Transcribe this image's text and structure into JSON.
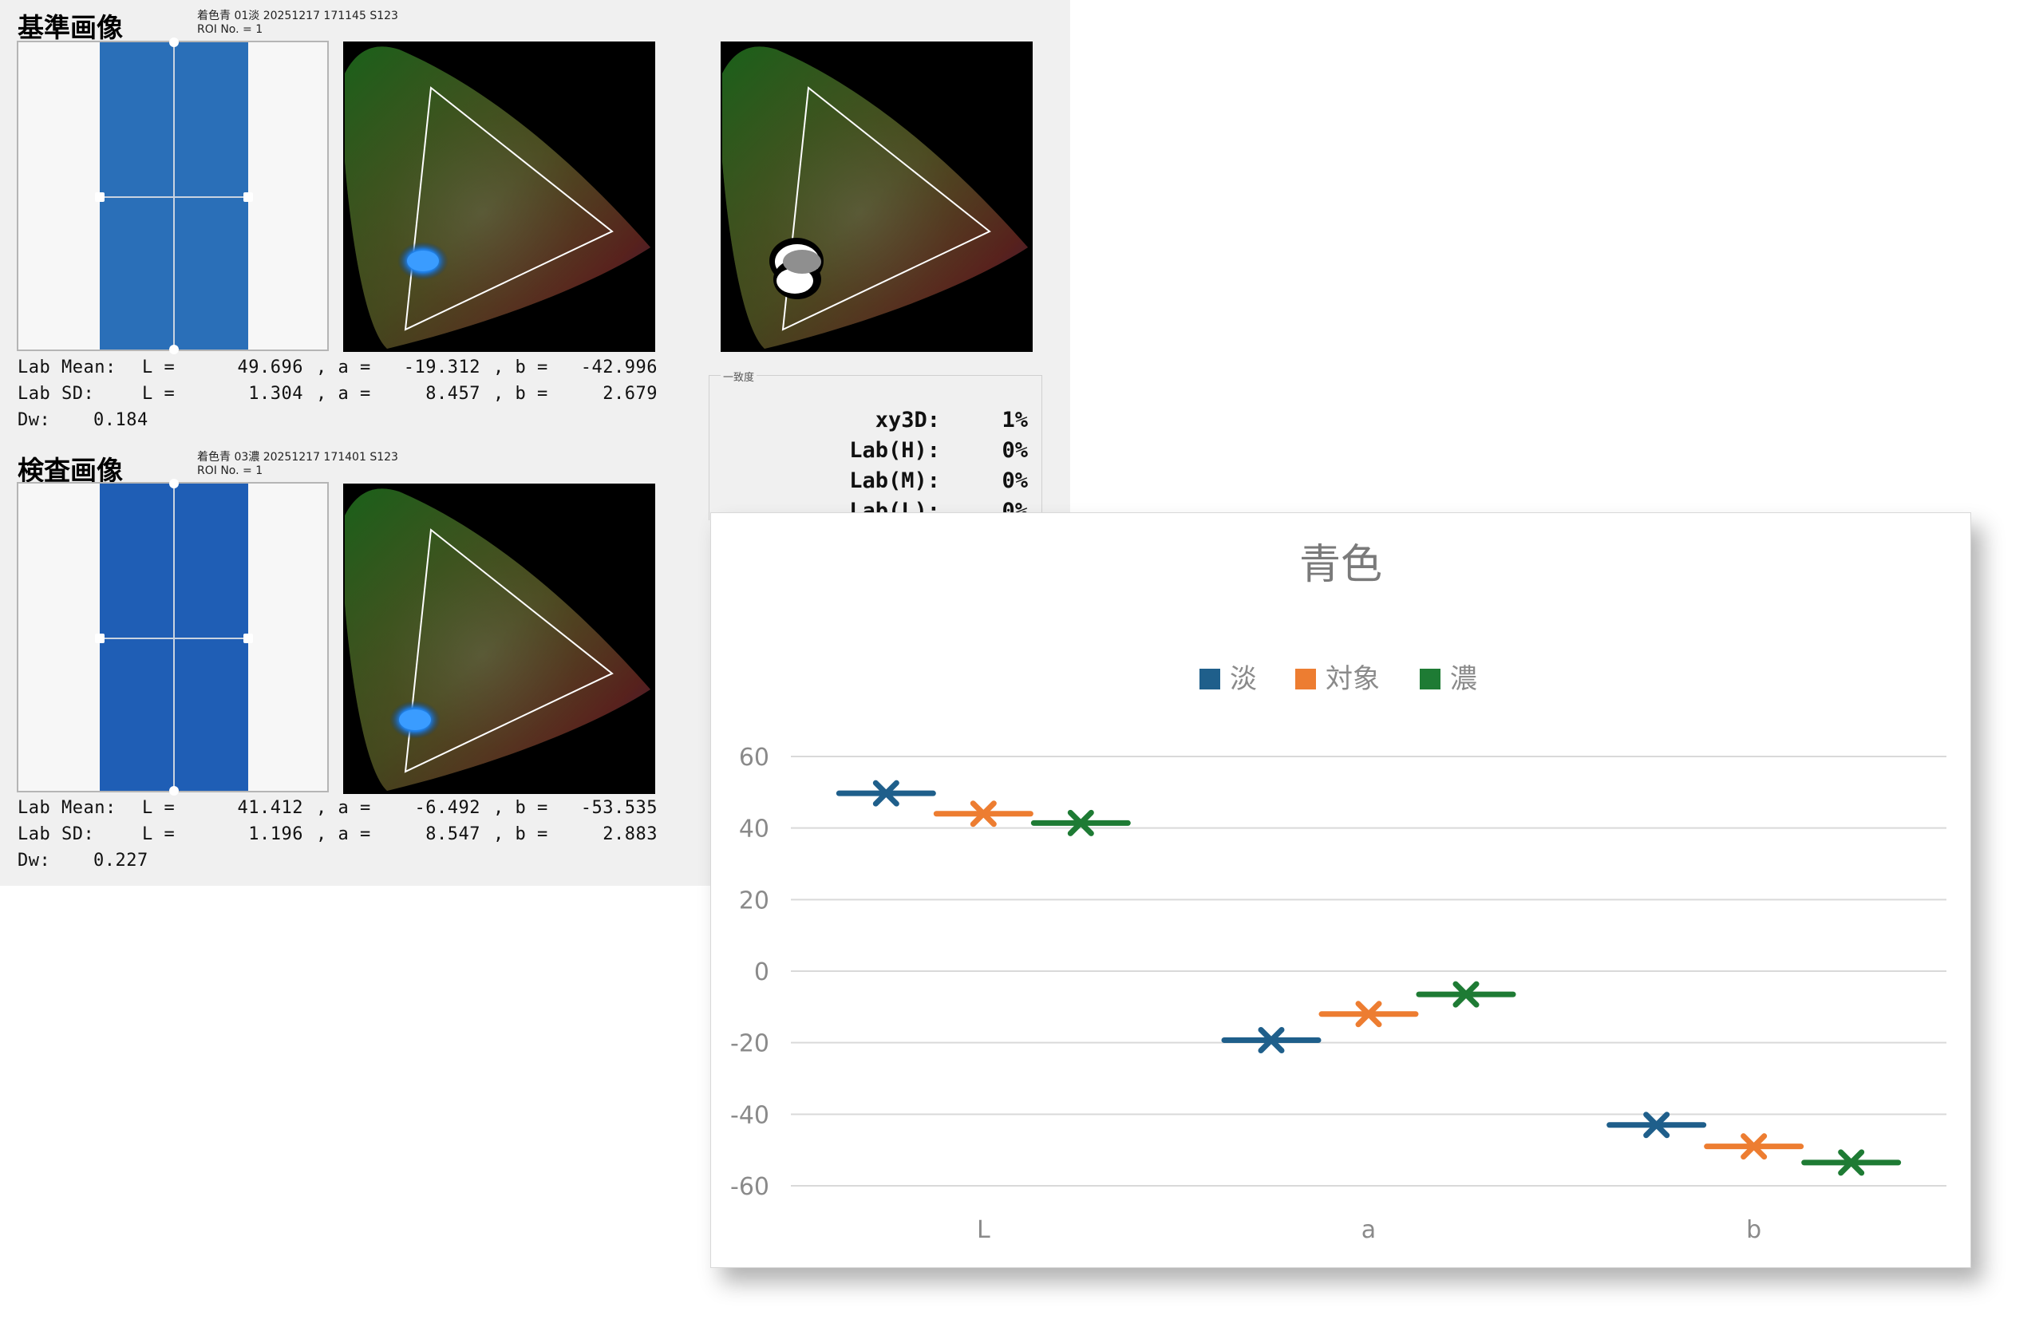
{
  "reference": {
    "title": "基準画像",
    "meta_line1": "着色青 01淡 20251217 171145 S123",
    "meta_line2": "ROI No. = 1",
    "roi_color": "#2a6fb8",
    "lab_mean": {
      "label": "Lab Mean:",
      "L": "49.696",
      "a": "-19.312",
      "b": "-42.996"
    },
    "lab_sd": {
      "label": "Lab SD:",
      "L": "1.304",
      "a": "8.457",
      "b": "2.679"
    },
    "dw": {
      "label": "Dw:",
      "value": "0.184"
    }
  },
  "inspection": {
    "title": "検査画像",
    "meta_line1": "着色青 03濃 20251217 171401 S123",
    "meta_line2": "ROI No. = 1",
    "roi_color": "#1f5eb5",
    "lab_mean": {
      "label": "Lab Mean:",
      "L": "41.412",
      "a": "-6.492",
      "b": "-53.535"
    },
    "lab_sd": {
      "label": "Lab SD:",
      "L": "1.196",
      "a": "8.547",
      "b": "2.883"
    },
    "dw": {
      "label": "Dw:",
      "value": "0.227"
    }
  },
  "consistency": {
    "group_label": "一致度",
    "rows": [
      {
        "label": "xy3D:",
        "value": "1%"
      },
      {
        "label": "Lab(H):",
        "value": "0%"
      },
      {
        "label": "Lab(M):",
        "value": "0%"
      },
      {
        "label": "Lab(L):",
        "value": "0%"
      }
    ]
  },
  "chart_data": {
    "type": "scatter",
    "title": "青色",
    "categories": [
      "L",
      "a",
      "b"
    ],
    "series": [
      {
        "name": "淡",
        "color": "#1f5f8b",
        "values": [
          49.7,
          -19.3,
          -43.0
        ]
      },
      {
        "name": "対象",
        "color": "#ed7d31",
        "values": [
          44.0,
          -12.0,
          -49.0
        ]
      },
      {
        "name": "濃",
        "color": "#1e7b34",
        "values": [
          41.4,
          -6.5,
          -53.5
        ]
      }
    ],
    "ylim": [
      -60,
      60
    ],
    "yticks": [
      "60",
      "40",
      "20",
      "0",
      "-20",
      "-40",
      "-60"
    ],
    "grid": true,
    "legend": "top",
    "marker": "x with horizontal bar"
  }
}
